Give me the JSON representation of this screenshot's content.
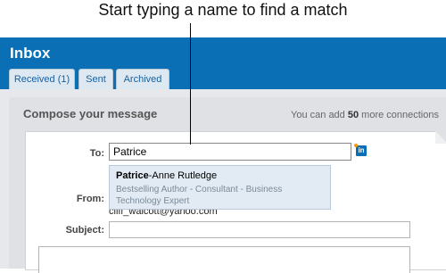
{
  "callout": {
    "text": "Start typing a name to find a match"
  },
  "header": {
    "title": "Inbox"
  },
  "tabs": [
    {
      "label": "Received (1)"
    },
    {
      "label": "Sent"
    },
    {
      "label": "Archived"
    }
  ],
  "compose": {
    "title": "Compose your message",
    "connections_prefix": "You can add ",
    "connections_count": "50",
    "connections_suffix": " more connections"
  },
  "form": {
    "to_label": "To:",
    "to_value": "Patrice",
    "from_label": "From:",
    "from_email": "cliff_walcott@yahoo.com",
    "subject_label": "Subject:",
    "subject_value": "",
    "linkedin_icon_text": "in"
  },
  "suggestion": {
    "match": "Patrice",
    "rest": "-Anne Rutledge",
    "description": "Bestselling Author - Consultant - Business Technology Expert"
  },
  "colors": {
    "header_blue": "#0a6fb5",
    "dropdown_bg": "#e2ebf4"
  }
}
